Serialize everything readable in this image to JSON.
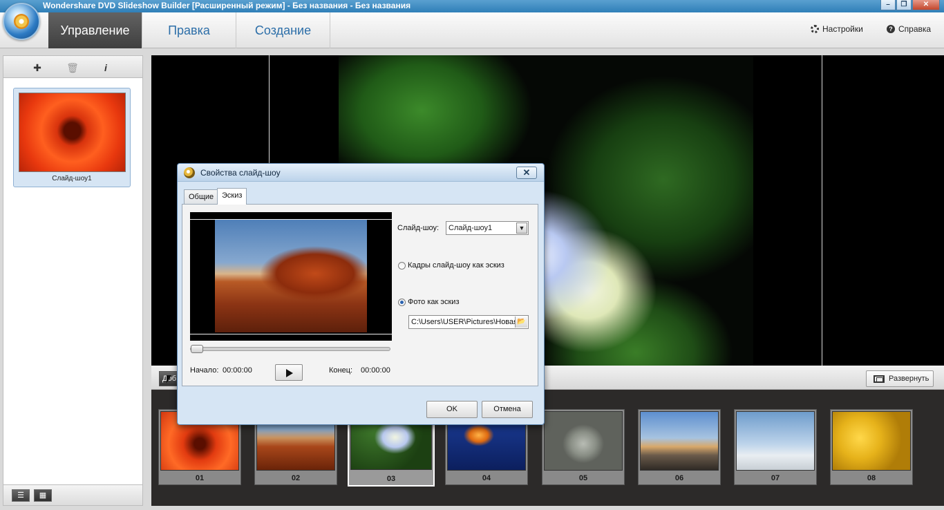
{
  "window": {
    "title": "Wondershare DVD Slideshow Builder [Расширенный режим] - Без названия - Без названия",
    "minimize": "–",
    "restore": "❐",
    "close": "✕"
  },
  "menubar": {
    "tabs": [
      {
        "label": "Управление",
        "active": true
      },
      {
        "label": "Правка",
        "active": false
      },
      {
        "label": "Создание",
        "active": false
      }
    ],
    "settings_label": "Настройки",
    "help_label": "Справка"
  },
  "left_panel": {
    "toolbar_icons": [
      "add-slideshow-icon",
      "trash-icon",
      "info-icon"
    ],
    "slideshow_label": "Слайд-шоу1",
    "view_buttons": [
      "list-view-icon",
      "thumbnail-view-icon"
    ]
  },
  "controls": {
    "add_button_label": "Доб",
    "expand_label": "Развернуть"
  },
  "storyboard": {
    "thumbnails": [
      {
        "num": "01",
        "subject": "red-flower",
        "color": "#e23b10"
      },
      {
        "num": "02",
        "subject": "desert",
        "color": "#a8461a"
      },
      {
        "num": "03",
        "subject": "hydrangea",
        "color": "#3f7a2c",
        "selected": true
      },
      {
        "num": "04",
        "subject": "jellyfish",
        "color": "#1c3e9a"
      },
      {
        "num": "05",
        "subject": "koala",
        "color": "#8a8f86"
      },
      {
        "num": "06",
        "subject": "lighthouse",
        "color": "#6a5a4a"
      },
      {
        "num": "07",
        "subject": "penguins",
        "color": "#6e9ccc"
      },
      {
        "num": "08",
        "subject": "tulips",
        "color": "#e6b21a"
      }
    ]
  },
  "dialog": {
    "title": "Свойства слайд-шоу",
    "close": "✕",
    "tabs": [
      {
        "label": "Общие",
        "active": false
      },
      {
        "label": "Эскиз",
        "active": true
      }
    ],
    "start_label": "Начало:",
    "start_value": "00:00:00",
    "end_label": "Конец:",
    "end_value": "00:00:00",
    "slideshow_label": "Слайд-шоу:",
    "slideshow_value": "Слайд-шоу1",
    "option_frames": "Кадры слайд-шоу как эскиз",
    "option_photo": "Фото как эскиз",
    "selected_option": "photo",
    "path_value": "C:\\Users\\USER\\Pictures\\Новая",
    "ok_label": "OK",
    "cancel_label": "Отмена"
  },
  "colors": {
    "accent_blue": "#2c6ea8",
    "active_tab": "#4a4a4a",
    "dialog_bg": "#d6e5f4",
    "storyboard_bg": "#2c2a29"
  }
}
